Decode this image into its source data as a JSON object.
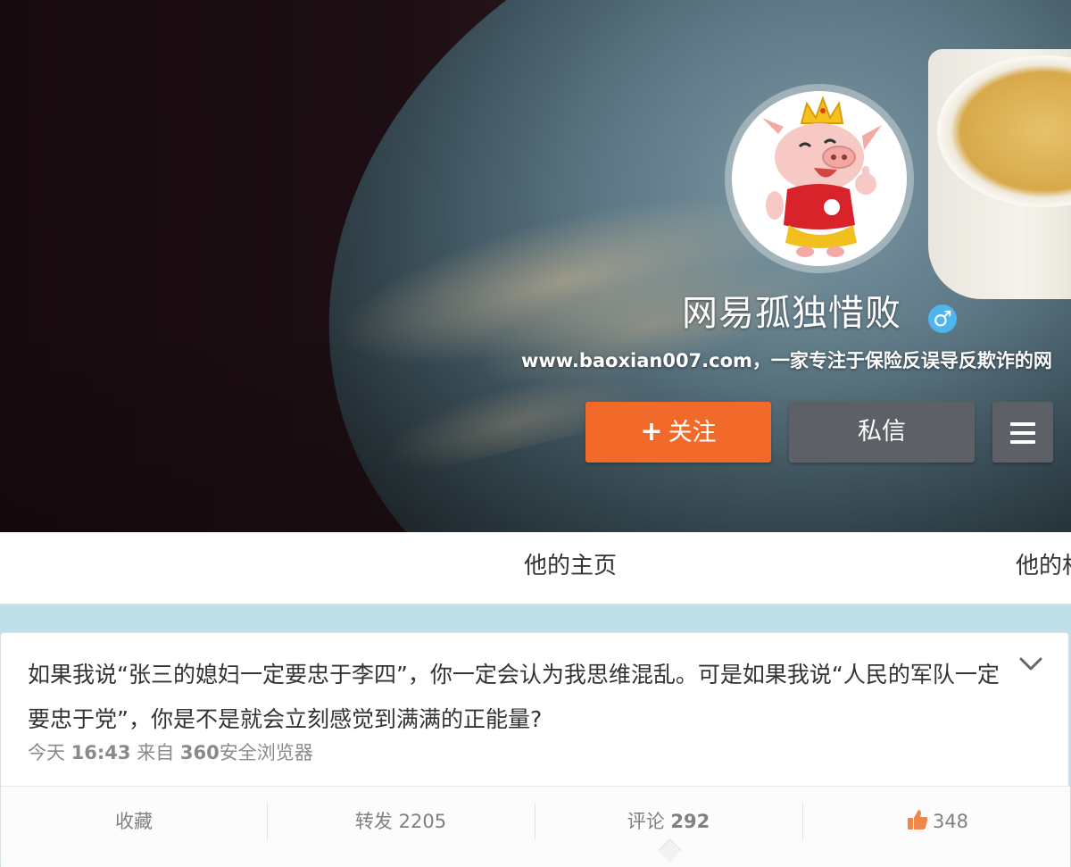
{
  "profile": {
    "name": "网易孤独惜败",
    "gender_symbol": "♂",
    "bio": "www.baoxian007.com，一家专注于保险反误导反欺诈的网",
    "follow_label": "关注",
    "follow_symbol": "+",
    "message_label": "私信"
  },
  "tabs": [
    {
      "label": "他的主页"
    },
    {
      "label": "他的相"
    }
  ],
  "post": {
    "text": "如果我说“张三的媳妇一定要忠于李四”，你一定会认为我思维混乱。可是如果我说“人民的军队一定要忠于党”，你是不是就会立刻感觉到满满的正能量?",
    "time_prefix": "今天",
    "time": "16:43",
    "source_prefix": "来自",
    "source_num": "360",
    "source_name": "安全浏览器",
    "actions": {
      "favorite_label": "收藏",
      "repost_label": "转发",
      "repost_count": "2205",
      "comment_label": "评论",
      "comment_count": "292",
      "like_count": "348"
    }
  },
  "colors": {
    "follow_button": "#f26a2a",
    "dark_button": "#5d6167",
    "gender_badge": "#4fb5ee",
    "page_background": "#bfe0e8",
    "like_icon": "#f0864a"
  },
  "icons": {
    "gender": "male-symbol-icon",
    "more": "hamburger-menu-icon",
    "expand": "chevron-down-icon",
    "like": "thumbs-up-icon"
  }
}
